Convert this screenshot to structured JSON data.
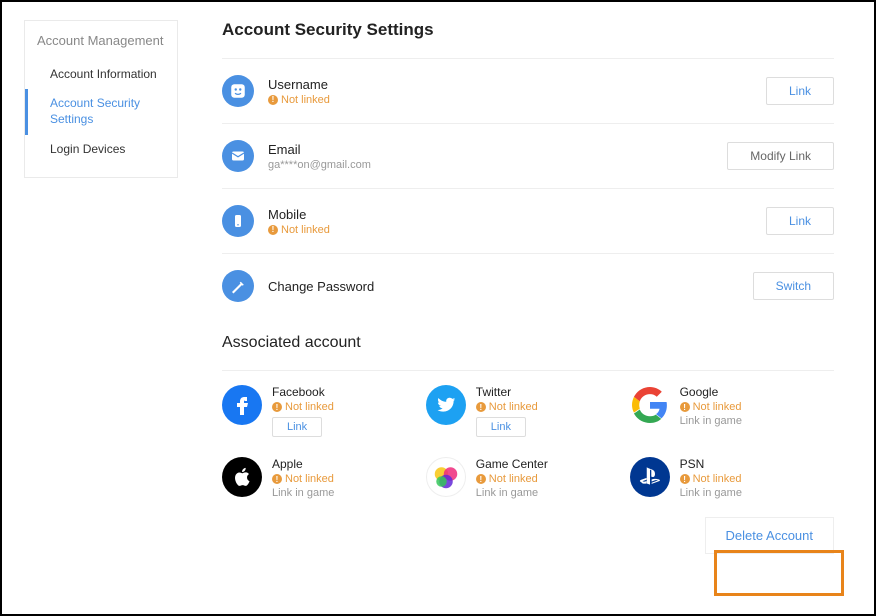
{
  "sidebar": {
    "title": "Account Management",
    "items": [
      {
        "label": "Account Information"
      },
      {
        "label": "Account Security Settings"
      },
      {
        "label": "Login Devices"
      }
    ]
  },
  "page_title": "Account Security Settings",
  "rows": {
    "username": {
      "label": "Username",
      "status": "Not linked",
      "button": "Link"
    },
    "email": {
      "label": "Email",
      "value": "ga****on@gmail.com",
      "button": "Modify Link"
    },
    "mobile": {
      "label": "Mobile",
      "status": "Not linked",
      "button": "Link"
    },
    "password": {
      "label": "Change Password",
      "button": "Switch"
    }
  },
  "associated_title": "Associated account",
  "associated": [
    {
      "name": "Facebook",
      "status": "Not linked",
      "button": "Link"
    },
    {
      "name": "Twitter",
      "status": "Not linked",
      "button": "Link"
    },
    {
      "name": "Google",
      "status": "Not linked",
      "sub": "Link in game"
    },
    {
      "name": "Apple",
      "status": "Not linked",
      "sub": "Link in game"
    },
    {
      "name": "Game Center",
      "status": "Not linked",
      "sub": "Link in game"
    },
    {
      "name": "PSN",
      "status": "Not linked",
      "sub": "Link in game"
    }
  ],
  "delete_label": "Delete Account",
  "status_exclaim": "!"
}
